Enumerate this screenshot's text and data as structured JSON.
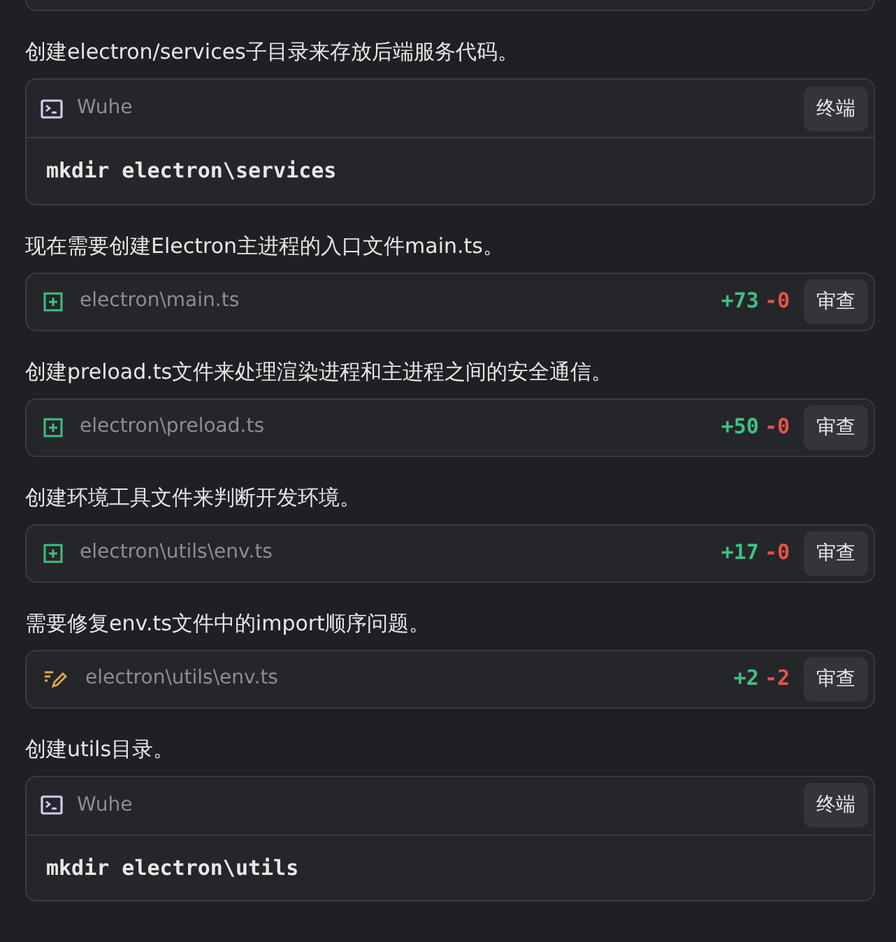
{
  "blocks": [
    {
      "kind": "text",
      "text": "创建electron/services子目录来存放后端服务代码。"
    },
    {
      "kind": "terminal",
      "title": "Wuhe",
      "button": "终端",
      "command": "mkdir electron\\services"
    },
    {
      "kind": "text",
      "text": "现在需要创建Electron主进程的入口文件main.ts。"
    },
    {
      "kind": "added_file",
      "path": "electron\\main.ts",
      "added": "+73",
      "removed": "-0",
      "button": "审查"
    },
    {
      "kind": "text",
      "text": "创建preload.ts文件来处理渲染进程和主进程之间的安全通信。"
    },
    {
      "kind": "added_file",
      "path": "electron\\preload.ts",
      "added": "+50",
      "removed": "-0",
      "button": "审查"
    },
    {
      "kind": "text",
      "text": "创建环境工具文件来判断开发环境。"
    },
    {
      "kind": "added_file",
      "path": "electron\\utils\\env.ts",
      "added": "+17",
      "removed": "-0",
      "button": "审查"
    },
    {
      "kind": "text",
      "text": "需要修复env.ts文件中的import顺序问题。"
    },
    {
      "kind": "modified_file",
      "path": "electron\\utils\\env.ts",
      "added": "+2",
      "removed": "-2",
      "button": "审查"
    },
    {
      "kind": "text",
      "text": "创建utils目录。"
    },
    {
      "kind": "terminal",
      "title": "Wuhe",
      "button": "终端",
      "command": "mkdir electron\\utils"
    }
  ]
}
